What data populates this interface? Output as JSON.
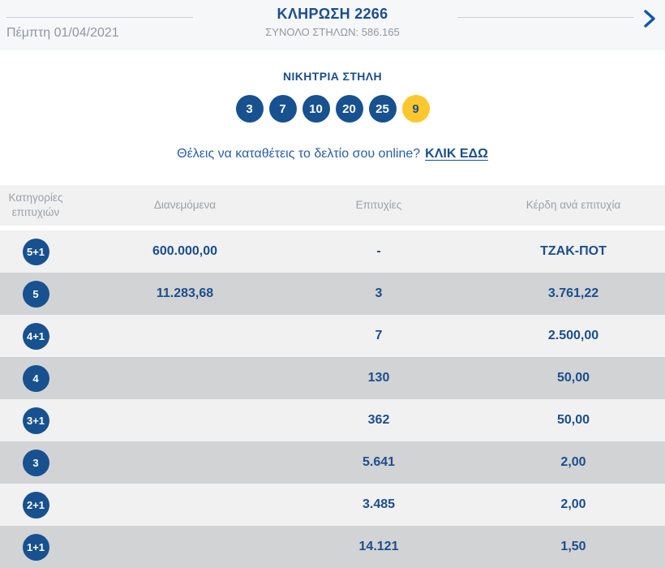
{
  "header": {
    "title": "ΚΛΗΡΩΣΗ 2266",
    "subtitle": "ΣΥΝΟΛΟ ΣΤΗΛΩΝ: 586.165",
    "date": "Πέμπτη 01/04/2021",
    "next_icon": "chevron-right"
  },
  "winning": {
    "heading": "ΝΙΚΗΤΡΙΑ ΣΤΗΛΗ",
    "numbers": [
      "3",
      "7",
      "10",
      "20",
      "25"
    ],
    "joker": "9"
  },
  "cta": {
    "text": "Θέλεις να καταθέτεις το δελτίο σου online?",
    "link_label": "ΚΛΙΚ ΕΔΩ"
  },
  "table": {
    "headers": [
      "Κατηγορίες επιτυχιών",
      "Διανεμόμενα",
      "Επιτυχίες",
      "Κέρδη ανά επιτυχία"
    ],
    "rows": [
      {
        "category": "5+1",
        "distributed": "600.000,00",
        "wins": "-",
        "prize": "ΤΖΑΚ-ΠΟΤ"
      },
      {
        "category": "5",
        "distributed": "11.283,68",
        "wins": "3",
        "prize": "3.761,22"
      },
      {
        "category": "4+1",
        "distributed": "",
        "wins": "7",
        "prize": "2.500,00"
      },
      {
        "category": "4",
        "distributed": "",
        "wins": "130",
        "prize": "50,00"
      },
      {
        "category": "3+1",
        "distributed": "",
        "wins": "362",
        "prize": "50,00"
      },
      {
        "category": "3",
        "distributed": "",
        "wins": "5.641",
        "prize": "2,00"
      },
      {
        "category": "2+1",
        "distributed": "",
        "wins": "3.485",
        "prize": "2,00"
      },
      {
        "category": "1+1",
        "distributed": "",
        "wins": "14.121",
        "prize": "1,50"
      }
    ]
  },
  "colors": {
    "navy": "#1b4e8c",
    "circle_blue": "#17518f",
    "joker_yellow": "#fdc72d",
    "row_light": "#f1f1f2",
    "row_dark": "#d2d3d4",
    "band_bg": "#f6f7f9",
    "muted_gray": "#8f97a1",
    "chevron_blue": "#0e57a8"
  }
}
